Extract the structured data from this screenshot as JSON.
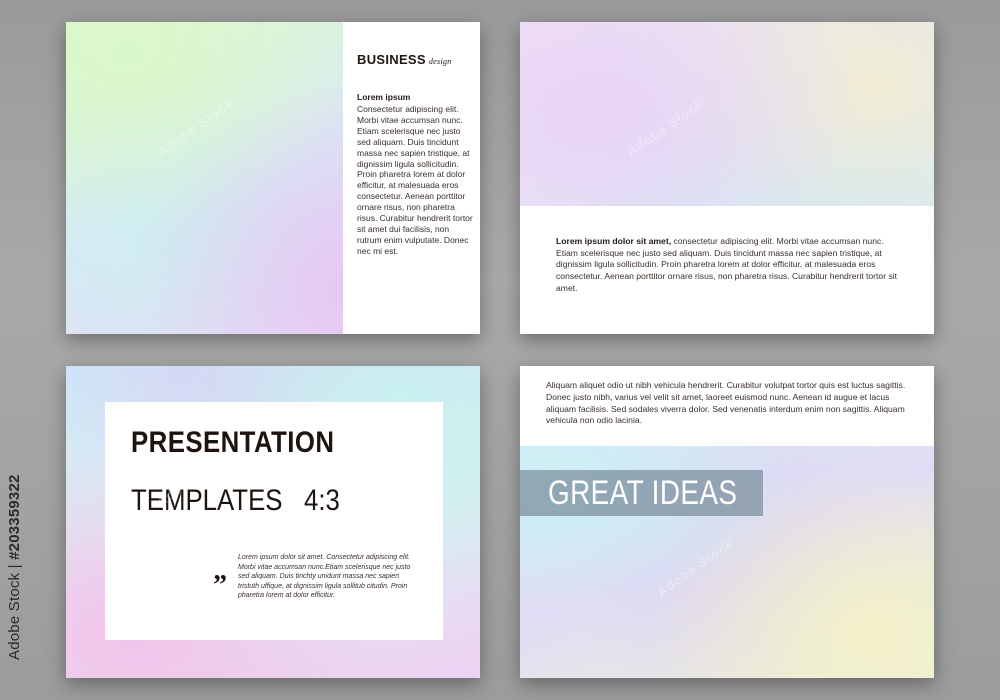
{
  "slide1": {
    "title": "BUSINESS",
    "subtitle": "design",
    "heading": "Lorem ipsum",
    "body": "Consectetur adipiscing elit. Morbi vitae accumsan nunc. Etiam scelerisque nec justo sed aliquam. Duis tincidunt massa nec sapien tristique, at dignissim ligula sollicitudin. Proin pharetra lorem at dolor efficitur, at malesuada eros consectetur. Aenean porttitor ornare risus, non pharetra risus. Curabitur hendrerit tortor sit amet dui facilisis, non rutrum enim vulputate. Donec nec mi est."
  },
  "slide2": {
    "lead": "Lorem ipsum dolor sit amet,",
    "body": " consectetur adipiscing elit. Morbi vitae accumsan nunc. Etiam scelerisque nec justo sed aliquam. Duis tincidunt massa nec sapien tristique, at dignissim ligula sollicitudin. Proin pharetra lorem at dolor efficitur, at malesuada eros consectetur. Aenean porttitor ornare risus, non pharetra risus. Curabitur hendrerit tortor sit amet."
  },
  "slide3": {
    "title_line1": "PRESENTATION",
    "title_line2": "TEMPLATES   4:3",
    "quote_mark": "”",
    "small_text": "Lorem ipsum dolor sit amet. Consectetur adipiscing elit. Morbi vitae accumsan nunc.Etiam scelerisque nec justo sed aliquam. Duis tinchty unidunt massa nec sapien tristuth uffique, at dignissim ligula sollitub citudin. Proin pharetra lorem at dolor efficitur."
  },
  "slide4": {
    "body": "Aliquam aliquet odio ut nibh vehicula hendrerit. Curabitur volutpat tortor quis est luctus sagittis. Donec justo nibh, varius vel velit sit amet, laoreet euismod nunc. Aenean id augue et lacus aliquam facilisis. Sed sodales viverra dolor. Sed venenatis interdum enim non sagittis. Aliquam vehicula non odio lacinia.",
    "banner": "GREAT IDEAS"
  },
  "stock_label": {
    "brand": "Adobe Stock",
    "separator": " | ",
    "id": "#203359322"
  },
  "watermark": "Adobe Stock",
  "colors": {
    "panel": "#ffffff",
    "text_dark": "#1e140f",
    "band": "#7a8c9d",
    "background": "#a3a3a3"
  }
}
